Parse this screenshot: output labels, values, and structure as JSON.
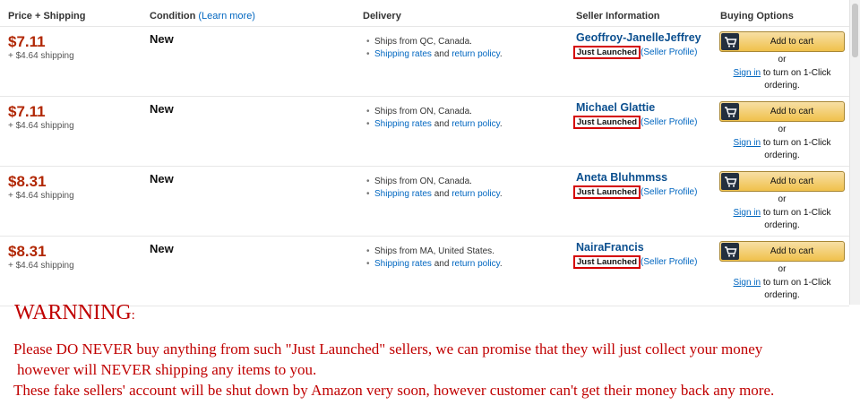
{
  "header": {
    "price_shipping": "Price + Shipping",
    "condition": "Condition",
    "learn_more": "(Learn more)",
    "delivery": "Delivery",
    "seller_information": "Seller Information",
    "buying_options": "Buying Options"
  },
  "offers": [
    {
      "price": "$7.11",
      "shipping": "+ $4.64 shipping",
      "condition": "New",
      "ships_from": "Ships from QC, Canada.",
      "shipping_rates": "Shipping rates",
      "and": "and",
      "return_policy": "return policy",
      "period": ".",
      "seller_name": "Geoffroy-JanelleJeffrey",
      "badge": "Just Launched",
      "seller_profile": "Seller Profile",
      "add_to_cart": "Add to cart",
      "or": "or",
      "sign_in": "Sign in",
      "oneclick_rest": "to turn on 1-Click ordering."
    },
    {
      "price": "$7.11",
      "shipping": "+ $4.64 shipping",
      "condition": "New",
      "ships_from": "Ships from ON, Canada.",
      "shipping_rates": "Shipping rates",
      "and": "and",
      "return_policy": "return policy",
      "period": ".",
      "seller_name": "Michael Glattie",
      "badge": "Just Launched",
      "seller_profile": "Seller Profile",
      "add_to_cart": "Add to cart",
      "or": "or",
      "sign_in": "Sign in",
      "oneclick_rest": "to turn on 1-Click ordering."
    },
    {
      "price": "$8.31",
      "shipping": "+ $4.64 shipping",
      "condition": "New",
      "ships_from": "Ships from ON, Canada.",
      "shipping_rates": "Shipping rates",
      "and": "and",
      "return_policy": "return policy",
      "period": ".",
      "seller_name": "Aneta Bluhmmss",
      "badge": "Just Launched",
      "seller_profile": "Seller Profile",
      "add_to_cart": "Add to cart",
      "or": "or",
      "sign_in": "Sign in",
      "oneclick_rest": "to turn on 1-Click ordering."
    },
    {
      "price": "$8.31",
      "shipping": "+ $4.64 shipping",
      "condition": "New",
      "ships_from": "Ships from MA, United States.",
      "shipping_rates": "Shipping rates",
      "and": "and",
      "return_policy": "return policy",
      "period": ".",
      "seller_name": "NairaFrancis",
      "badge": "Just Launched",
      "seller_profile": "Seller Profile",
      "add_to_cart": "Add to cart",
      "or": "or",
      "sign_in": "Sign in",
      "oneclick_rest": "to turn on 1-Click ordering."
    }
  ],
  "warning": {
    "title": "WARNNING",
    "colon": ":",
    "line1": "Please DO NEVER buy anything from such \"Just Launched\" sellers, we can promise that they will just collect your money",
    "line2": "however will NEVER shipping any items to you.",
    "line3": "These fake sellers' account will be shut down by Amazon very soon, however customer can't get their money back any more."
  },
  "colors": {
    "price": "#b12704",
    "link": "#0066c0",
    "badge_border": "#d40000",
    "warning": "#c00000",
    "cart_button": "#f0c14b"
  },
  "icons": {
    "cart": "shopping-cart-icon",
    "bullet": "bullet-icon"
  }
}
